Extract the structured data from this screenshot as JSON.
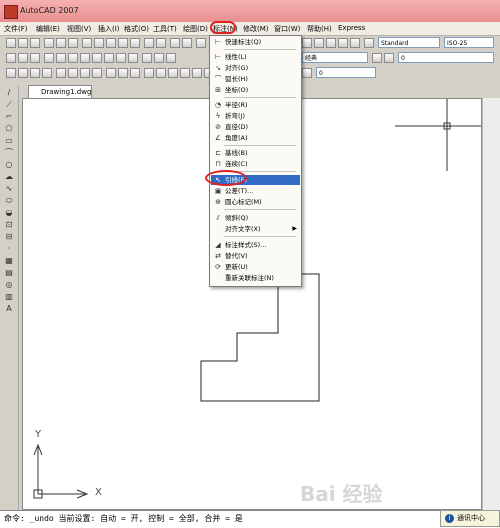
{
  "window": {
    "title": "AutoCAD 2007"
  },
  "menubar": {
    "items": [
      "文件(F)",
      "编辑(E)",
      "视图(V)",
      "插入(I)",
      "格式(O)",
      "工具(T)",
      "绘图(D)",
      "标注(N)",
      "修改(M)",
      "窗口(W)",
      "帮助(H)",
      "Express"
    ]
  },
  "toolbar": {
    "text_style": "Standard",
    "dim_style": "ISO-25",
    "layer": "0",
    "linetype": "经典",
    "layer_right": "0"
  },
  "tabs": {
    "drawing": "Drawing1.dwg"
  },
  "dimension_menu": {
    "items": [
      {
        "label": "快速标注(Q)",
        "icon": "quick-dimension-icon",
        "glyph": "⊢"
      },
      {
        "label": "线性(L)",
        "icon": "linear-icon",
        "glyph": "⊢"
      },
      {
        "label": "对齐(G)",
        "icon": "aligned-icon",
        "glyph": "↘"
      },
      {
        "label": "弧长(H)",
        "icon": "arc-length-icon",
        "glyph": "⌒"
      },
      {
        "label": "坐标(O)",
        "icon": "ordinate-icon",
        "glyph": "⊞"
      },
      {
        "label": "半径(R)",
        "icon": "radius-icon",
        "glyph": "◔"
      },
      {
        "label": "折弯(J)",
        "icon": "jogged-icon",
        "glyph": "ϟ"
      },
      {
        "label": "直径(D)",
        "icon": "diameter-icon",
        "glyph": "⊘"
      },
      {
        "label": "角度(A)",
        "icon": "angular-icon",
        "glyph": "∠"
      },
      {
        "label": "基线(B)",
        "icon": "baseline-icon",
        "glyph": "⊏"
      },
      {
        "label": "连续(C)",
        "icon": "continue-icon",
        "glyph": "⊓"
      },
      {
        "label": "引线(E)",
        "icon": "leader-icon",
        "glyph": "↖"
      },
      {
        "label": "公差(T)...",
        "icon": "tolerance-icon",
        "glyph": "▣"
      },
      {
        "label": "圆心标记(M)",
        "icon": "center-mark-icon",
        "glyph": "⊕"
      },
      {
        "label": "倾斜(Q)",
        "icon": "oblique-icon",
        "glyph": "⫽"
      },
      {
        "label": "对齐文字(X)",
        "icon": "",
        "glyph": ""
      },
      {
        "label": "标注样式(S)...",
        "icon": "dimension-style-icon",
        "glyph": "◢"
      },
      {
        "label": "替代(V)",
        "icon": "override-icon",
        "glyph": "⇄"
      },
      {
        "label": "更新(U)",
        "icon": "update-icon",
        "glyph": "⟳"
      },
      {
        "label": "重新关联标注(N)",
        "icon": "",
        "glyph": ""
      }
    ]
  },
  "ucs": {
    "x_label": "X",
    "y_label": "Y"
  },
  "command": {
    "text": "命令:  _undo 当前设置: 自动 = 开, 控制 = 全部, 合并 = 是"
  },
  "notification": {
    "label": "通讯中心"
  },
  "watermark": {
    "text": "Bai 经验"
  }
}
